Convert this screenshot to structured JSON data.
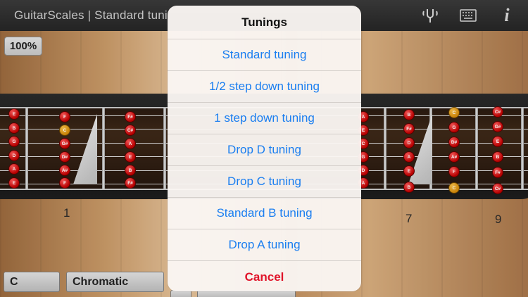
{
  "app": {
    "title": "GuitarScales | Standard tuni",
    "zoom": "100%"
  },
  "toolbar": {
    "tuner_icon": "tuning-fork-icon",
    "keyboard_icon": "keyboard-icon",
    "info_icon": "info-icon",
    "info_glyph": "i"
  },
  "fretboard": {
    "fret_numbers": [
      "1",
      "7",
      "9"
    ],
    "open_strings": [
      "E",
      "B",
      "G",
      "D",
      "A",
      "E"
    ],
    "fret1_notes": [
      "F",
      "C",
      "G#",
      "D#",
      "A#",
      "F"
    ],
    "fret2_notes": [
      "F#",
      "C#",
      "A",
      "E",
      "B",
      "F#"
    ],
    "fret7_notes": [
      "B",
      "F#",
      "D",
      "A",
      "E",
      "B"
    ],
    "fret8_notes": [
      "C",
      "G",
      "D#",
      "A#",
      "F",
      "C"
    ],
    "fret9_notes": [
      "C#",
      "G#",
      "E",
      "B",
      "F#",
      "C#"
    ],
    "right_edge_notes": [
      "A",
      "E",
      "C",
      "G",
      "D",
      "A"
    ],
    "root_note": "C",
    "root_color": "#e8a020",
    "note_color": "#d40000"
  },
  "bottom_bar": {
    "key": "C",
    "scale": "Chromatic"
  },
  "sheet": {
    "title": "Tunings",
    "options": [
      "Standard tuning",
      "1/2 step down tuning",
      "1 step down tuning",
      "Drop D tuning",
      "Drop C tuning",
      "Standard B tuning",
      "Drop A tuning"
    ],
    "cancel": "Cancel",
    "option_color": "#1a7ef0",
    "cancel_color": "#e0142a"
  }
}
